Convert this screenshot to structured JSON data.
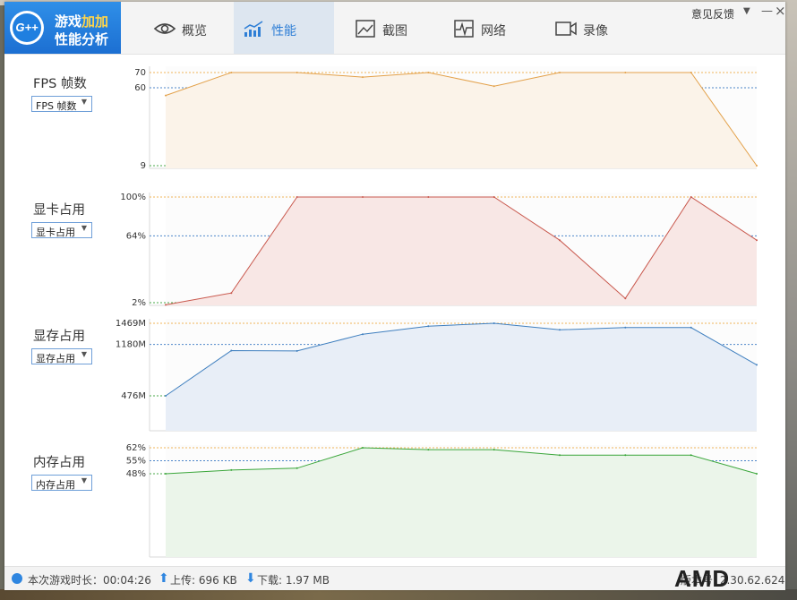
{
  "app": {
    "logo_text_1a": "游戏",
    "logo_text_1b": "加加",
    "logo_text_2": "性能分析",
    "logo_badge": "G++"
  },
  "tabs": [
    {
      "label": "概览",
      "icon": "eye-icon"
    },
    {
      "label": "性能",
      "icon": "performance-chart-icon",
      "active": true
    },
    {
      "label": "截图",
      "icon": "image-icon"
    },
    {
      "label": "网络",
      "icon": "pulse-icon"
    },
    {
      "label": "录像",
      "icon": "video-camera-icon"
    }
  ],
  "window_controls": {
    "feedback": "意见反馈",
    "menu": "▼",
    "minimize": "—",
    "close": "×"
  },
  "charts": [
    {
      "label": "FPS 帧数",
      "selector": "FPS 帧数",
      "color": "#e3a14a",
      "fill": "#fbf3e9",
      "ticks": [
        "70",
        "60",
        "9"
      ],
      "ref_values": {
        "max": 70,
        "avg": 60,
        "min": 9
      },
      "values": [
        55,
        70,
        70,
        67,
        70,
        61,
        70,
        70,
        70,
        9
      ]
    },
    {
      "label": "显卡占用",
      "selector": "显卡占用",
      "color": "#c9594e",
      "fill": "#f8e7e5",
      "ticks": [
        "100%",
        "64%",
        "2%"
      ],
      "ref_values": {
        "max": 100,
        "avg": 64,
        "min": 2
      },
      "values": [
        0,
        11,
        100,
        100,
        100,
        100,
        60,
        6,
        100,
        60
      ]
    },
    {
      "label": "显存占用",
      "selector": "显存占用",
      "color": "#3f7fbf",
      "fill": "#e8eef7",
      "ticks": [
        "1469M",
        "1180M",
        "476M"
      ],
      "ref_values": {
        "max": 1469,
        "avg": 1180,
        "min": 476
      },
      "values": [
        476,
        1095,
        1090,
        1320,
        1430,
        1469,
        1380,
        1410,
        1410,
        900
      ]
    },
    {
      "label": "内存占用",
      "selector": "内存占用",
      "color": "#3aa63a",
      "fill": "#ebf5ea",
      "ticks": [
        "62%",
        "55%",
        "48%"
      ],
      "ref_values": {
        "max": 62,
        "avg": 55,
        "min": 48
      },
      "values": [
        48,
        50,
        51,
        62,
        61,
        61,
        58,
        58,
        58,
        48
      ]
    }
  ],
  "footer": {
    "session_time": "本次游戏时长：00:04:26",
    "upload": "上传: 696 KB",
    "download": "下载: 1.97 MB",
    "brand": "AMD",
    "version": "版本号: 2.30.62.624"
  }
}
